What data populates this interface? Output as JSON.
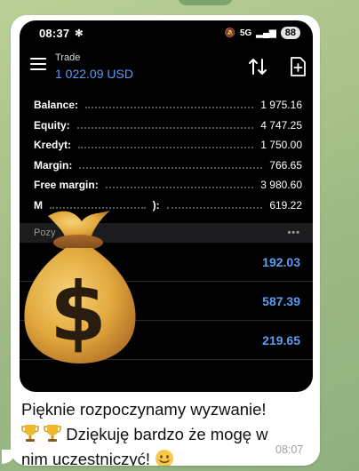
{
  "status_bar": {
    "time": "08:37",
    "network": "5G",
    "battery": "88"
  },
  "app": {
    "title": "Trade",
    "balance_header": "1 022.09 USD"
  },
  "summary": [
    {
      "label": "Balance:",
      "value": "1 975.16"
    },
    {
      "label": "Equity:",
      "value": "4 747.25"
    },
    {
      "label": "Kredyt:",
      "value": "1 750.00"
    },
    {
      "label": "Margin:",
      "value": "766.65"
    },
    {
      "label": "Free margin:",
      "value": "3 980.60"
    },
    {
      "label": "M",
      "suffix": "):",
      "value": "619.22"
    }
  ],
  "positions": {
    "header_label": "Pozy",
    "more": "•••",
    "rows": [
      {
        "value": "192.03"
      },
      {
        "value": "587.39"
      },
      {
        "value": "219.65"
      }
    ]
  },
  "message": {
    "line1": "Pięknie rozpoczynamy wyzwanie!",
    "line2_text": " Dziękuję bardzo że mogę w",
    "line3_text": "nim uczestniczyć! ",
    "time": "08:07",
    "icons": [
      "trophy-icon",
      "trophy-icon",
      "smiling-face-icon",
      "money-bag-icon"
    ]
  },
  "colors": {
    "accent_blue": "#5b9cf5",
    "phone_bg": "#000000",
    "chat_bg": "#a7c08c"
  }
}
